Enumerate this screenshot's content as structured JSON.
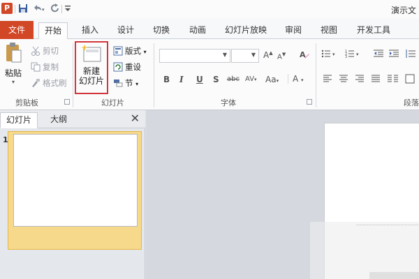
{
  "titlebar": {
    "app_logo": "P",
    "window_title": "演示文",
    "qat_icons": [
      "save-icon",
      "undo-icon",
      "redo-icon",
      "customize-qat-icon"
    ]
  },
  "ribbon_tabs": {
    "file": "文件",
    "items": [
      "开始",
      "插入",
      "设计",
      "切换",
      "动画",
      "幻灯片放映",
      "审阅",
      "视图",
      "开发工具"
    ],
    "active": "开始"
  },
  "clipboard": {
    "paste": "粘贴",
    "cut": "剪切",
    "copy": "复制",
    "format_painter": "格式刷",
    "label": "剪贴板"
  },
  "slides": {
    "new_slide_line1": "新建",
    "new_slide_line2": "幻灯片",
    "layout": "版式",
    "reset": "重设",
    "section": "节",
    "label": "幻灯片"
  },
  "font": {
    "font_name": "",
    "font_size": "",
    "bold": "B",
    "italic": "I",
    "underline": "U",
    "shadow": "S",
    "strikethrough": "abc",
    "char_spacing": "AV",
    "change_case": "Aa",
    "font_color": "A",
    "label": "字体"
  },
  "paragraph": {
    "label": "段落"
  },
  "pane": {
    "tab_slides": "幻灯片",
    "tab_outline": "大纲",
    "close": "✕",
    "slide_number": "1"
  },
  "colors": {
    "accent": "#d24726",
    "highlight": "#f6d98a",
    "red_outline": "#d3363a"
  }
}
